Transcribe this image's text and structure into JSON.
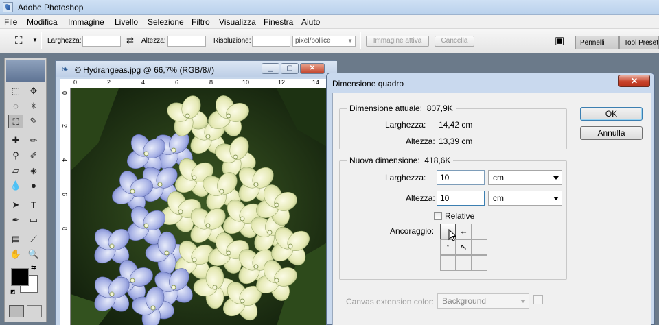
{
  "app": {
    "title": "Adobe Photoshop"
  },
  "menu": [
    "File",
    "Modifica",
    "Immagine",
    "Livello",
    "Selezione",
    "Filtro",
    "Visualizza",
    "Finestra",
    "Aiuto"
  ],
  "options": {
    "width_label": "Larghezza:",
    "width_value": "",
    "height_label": "Altezza:",
    "height_value": "",
    "resolution_label": "Risoluzione:",
    "resolution_value": "",
    "unit_value": "pixel/pollice",
    "active_image_button": "Immagine attiva",
    "cancel_button": "Cancella",
    "panel_tabs": [
      "Pennelli",
      "Tool Presets"
    ]
  },
  "document": {
    "title": "© Hydrangeas.jpg @ 66,7% (RGB/8#)",
    "ruler_h": [
      "0",
      "2",
      "4",
      "6",
      "8",
      "10",
      "12",
      "14"
    ],
    "ruler_v": [
      "0",
      "2",
      "4",
      "6",
      "8"
    ]
  },
  "dialog": {
    "title": "Dimensione quadro",
    "ok": "OK",
    "cancel": "Annulla",
    "current_size_label": "Dimensione attuale:",
    "current_size_value": "807,9K",
    "current_width_label": "Larghezza:",
    "current_width_value": "14,42 cm",
    "current_height_label": "Altezza:",
    "current_height_value": "13,39 cm",
    "new_size_label": "Nuova dimensione:",
    "new_size_value": "418,6K",
    "new_width_label": "Larghezza:",
    "new_width_value": "10",
    "new_width_unit": "cm",
    "new_height_label": "Altezza:",
    "new_height_value": "10",
    "new_height_unit": "cm",
    "relative_label": "Relative",
    "relative_checked": false,
    "anchor_label": "Ancoraggio:",
    "extension_color_label": "Canvas extension color:",
    "extension_color_value": "Background"
  }
}
